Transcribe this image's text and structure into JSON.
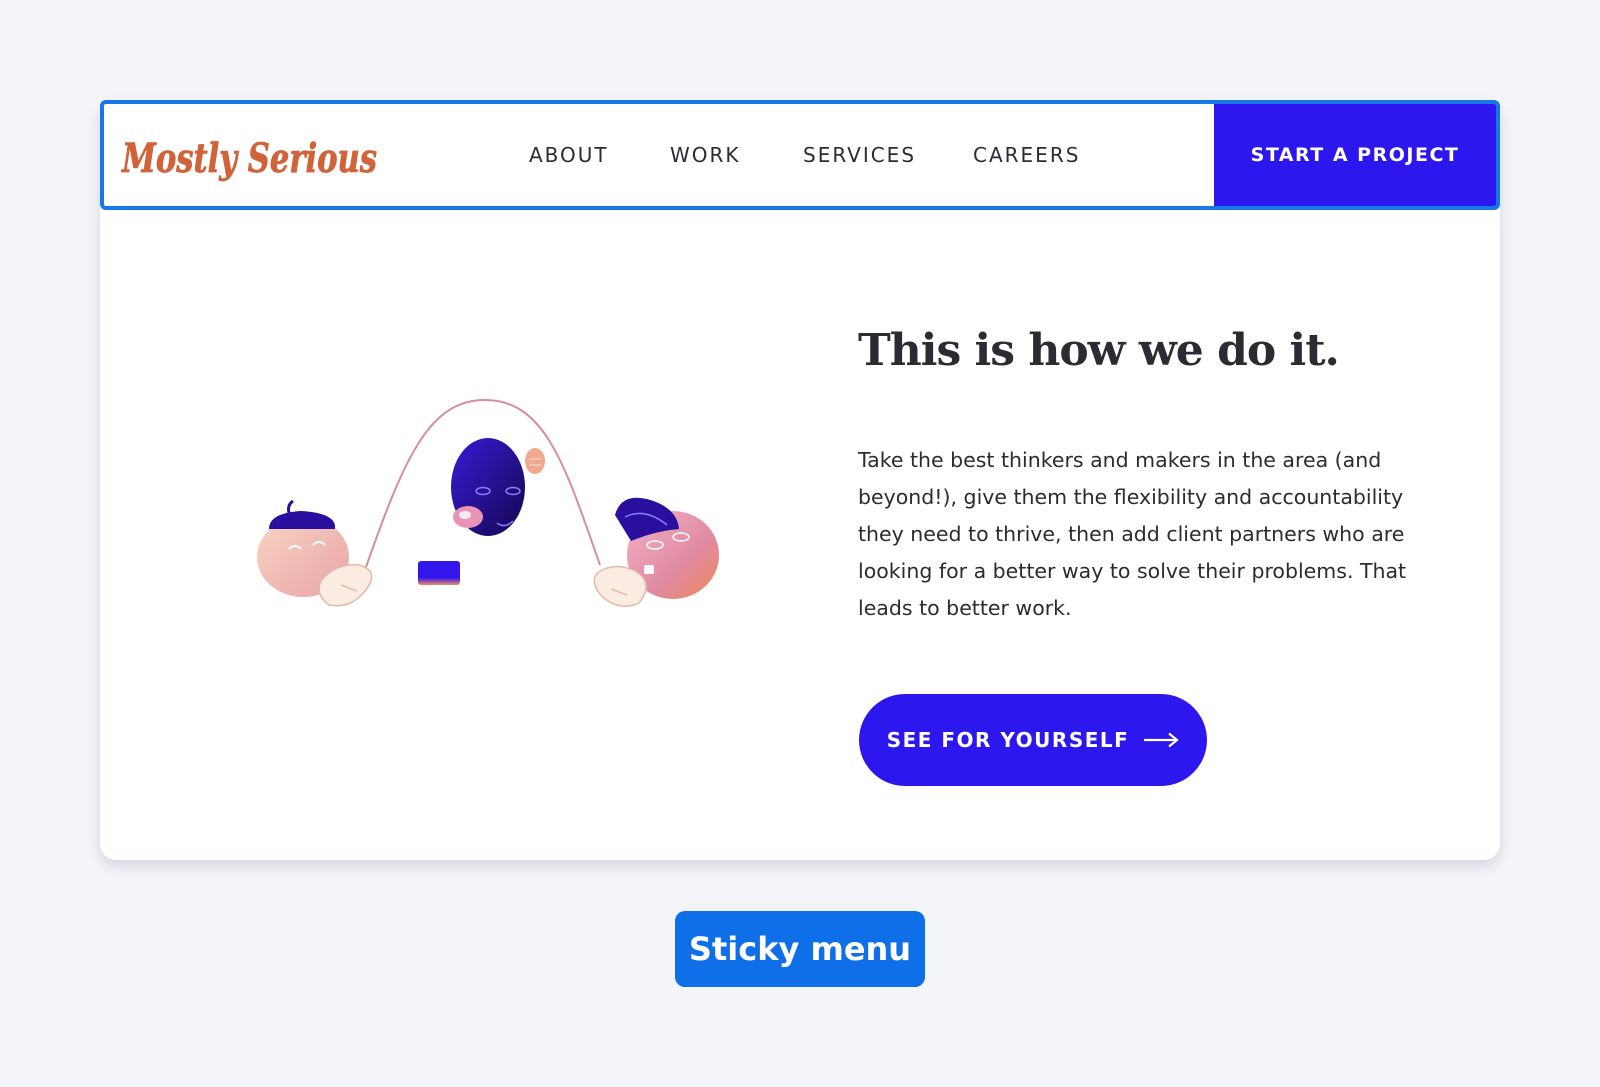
{
  "brand": {
    "name": "Mostly Serious",
    "logo_color": "#d0633a"
  },
  "nav": {
    "items": [
      {
        "label": "ABOUT"
      },
      {
        "label": "WORK"
      },
      {
        "label": "SERVICES"
      },
      {
        "label": "CAREERS"
      }
    ],
    "cta_label": "START A PROJECT"
  },
  "hero": {
    "headline": "This is how we do it.",
    "body": "Take the best thinkers and makers in the area (and beyond!), give them the flexibility and accountability they need to thrive, then add client partners who are looking for a better way to solve their problems. That leads to better work.",
    "button_label": "SEE FOR YOURSELF",
    "button_icon": "arrow-right-icon",
    "illustration": "jump-rope-characters-illustration"
  },
  "caption": {
    "label": "Sticky menu"
  },
  "colors": {
    "accent": "#2d17ee",
    "highlight_border": "#1677e6",
    "page_background": "#f3f5f9"
  }
}
